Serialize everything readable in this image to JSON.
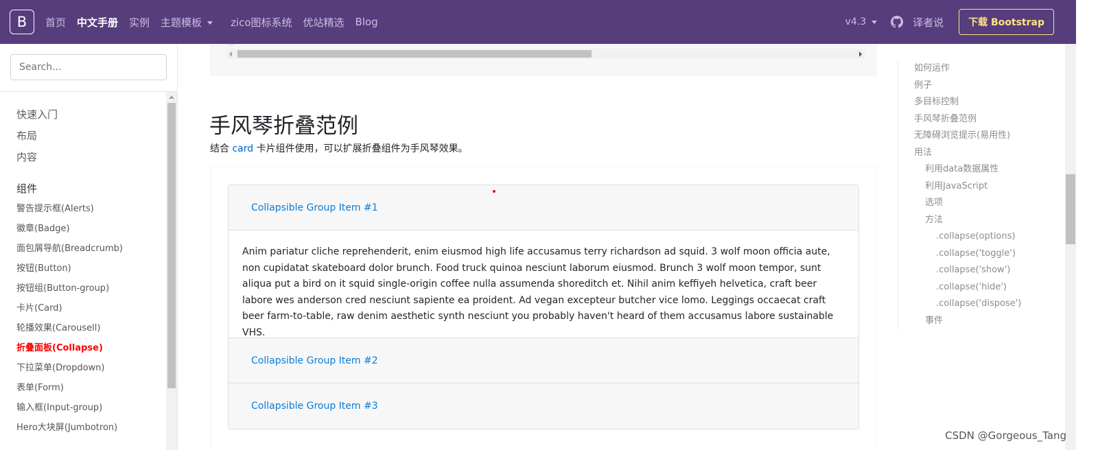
{
  "navbar": {
    "brand": "B",
    "items": [
      {
        "label": "首页",
        "active": false
      },
      {
        "label": "中文手册",
        "active": true
      },
      {
        "label": "实例",
        "active": false
      },
      {
        "label": "主题模板",
        "active": false,
        "dropdown": true
      },
      {
        "label": "zico图标系统",
        "active": false
      },
      {
        "label": "优站精选",
        "active": false
      },
      {
        "label": "Blog",
        "active": false
      }
    ],
    "version": "v4.3",
    "translator": "译者说",
    "download": "下载 Bootstrap"
  },
  "sidebar": {
    "search_placeholder": "Search...",
    "top_links": [
      "快速入门",
      "布局",
      "内容"
    ],
    "group_title": "组件",
    "items": [
      {
        "label": "警告提示框(Alerts)",
        "current": false
      },
      {
        "label": "徽章(Badge)",
        "current": false
      },
      {
        "label": "面包屑导航(Breadcrumb)",
        "current": false
      },
      {
        "label": "按钮(Button)",
        "current": false
      },
      {
        "label": "按钮组(Button-group)",
        "current": false
      },
      {
        "label": "卡片(Card)",
        "current": false
      },
      {
        "label": "轮播效果(Carousell)",
        "current": false
      },
      {
        "label": "折叠面板(Collapse)",
        "current": true
      },
      {
        "label": "下拉菜单(Dropdown)",
        "current": false
      },
      {
        "label": "表单(Form)",
        "current": false
      },
      {
        "label": "输入框(Input-group)",
        "current": false
      },
      {
        "label": "Hero大块屏(Jumbotron)",
        "current": false
      }
    ]
  },
  "main": {
    "code_hint": "...",
    "title": "手风琴折叠范例",
    "desc_prefix": "结合 ",
    "desc_link": "card",
    "desc_suffix": " 卡片组件使用，可以扩展折叠组件为手风琴效果。",
    "accordion": {
      "item1": "Collapsible Group Item #1",
      "body": "Anim pariatur cliche reprehenderit, enim eiusmod high life accusamus terry richardson ad squid. 3 wolf moon officia aute, non cupidatat skateboard dolor brunch. Food truck quinoa nesciunt laborum eiusmod. Brunch 3 wolf moon tempor, sunt aliqua put a bird on it squid single-origin coffee nulla assumenda shoreditch et. Nihil anim keffiyeh helvetica, craft beer labore wes anderson cred nesciunt sapiente ea proident. Ad vegan excepteur butcher vice lomo. Leggings occaecat craft beer farm-to-table, raw denim aesthetic synth nesciunt you probably haven't heard of them accusamus labore sustainable VHS.",
      "item2": "Collapsible Group Item #2",
      "item3": "Collapsible Group Item #3"
    }
  },
  "toc": [
    {
      "label": "如何运作",
      "level": 1
    },
    {
      "label": "例子",
      "level": 1
    },
    {
      "label": "多目标控制",
      "level": 1
    },
    {
      "label": "手风琴折叠范例",
      "level": 1
    },
    {
      "label": "无障碍浏览提示(易用性)",
      "level": 1
    },
    {
      "label": "用法",
      "level": 1
    },
    {
      "label": "利用data数据属性",
      "level": 2
    },
    {
      "label": "利用JavaScript",
      "level": 2
    },
    {
      "label": "选项",
      "level": 2
    },
    {
      "label": "方法",
      "level": 2
    },
    {
      "label": ".collapse(options)",
      "level": 3
    },
    {
      "label": ".collapse('toggle')",
      "level": 3
    },
    {
      "label": ".collapse('show')",
      "level": 3
    },
    {
      "label": ".collapse('hide')",
      "level": 3
    },
    {
      "label": ".collapse('dispose')",
      "level": 3
    },
    {
      "label": "事件",
      "level": 2
    }
  ],
  "watermark": "CSDN @Gorgeous_Tang",
  "colors": {
    "navbar": "#563d7c",
    "download": "#ffe484",
    "link": "#0a7bd8",
    "current": "#ff0000"
  }
}
